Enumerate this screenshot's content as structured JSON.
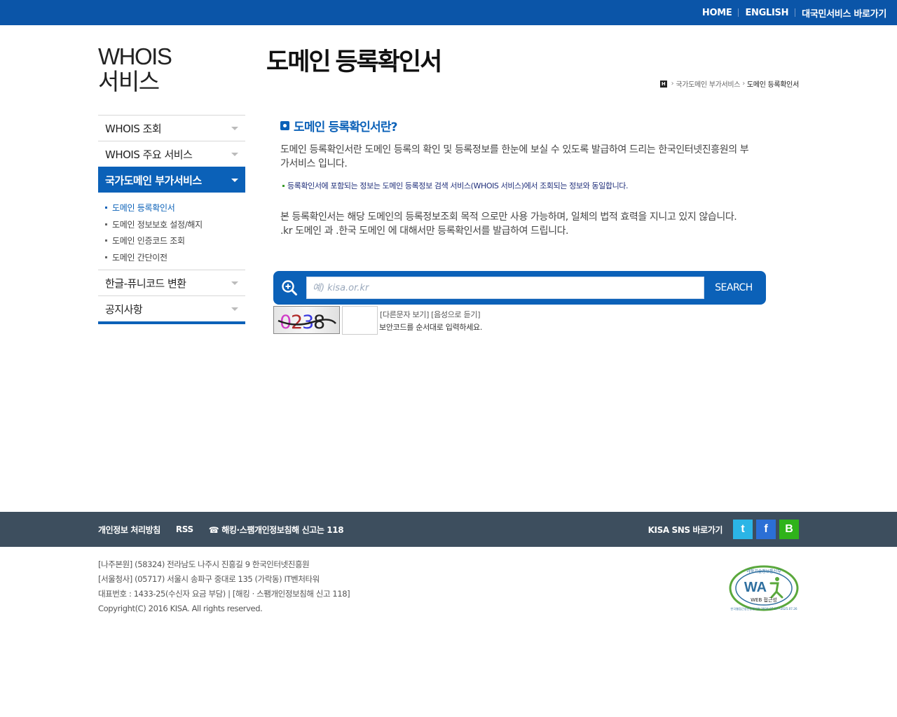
{
  "top_nav": {
    "home": "HOME",
    "english": "ENGLISH",
    "civil_service": "대국민서비스 바로가기"
  },
  "site_title": {
    "line1": "WHOIS",
    "line2": "서비스"
  },
  "page_title": "도메인 등록확인서",
  "breadcrumb": {
    "home_icon": "H",
    "item1": "국가도메인 부가서비스",
    "current": "도메인 등록확인서"
  },
  "side_menu": {
    "items": [
      {
        "label": "WHOIS 조회"
      },
      {
        "label": "WHOIS 주요 서비스"
      },
      {
        "label": "국가도메인 부가서비스"
      },
      {
        "label": "한글-퓨니코드 변환"
      },
      {
        "label": "공지사항"
      }
    ],
    "submenu": [
      {
        "label": "도메인 등록확인서"
      },
      {
        "label": "도메인 정보보호 설정/해지"
      },
      {
        "label": "도메인 인증코드 조회"
      },
      {
        "label": "도메인 간단이전"
      }
    ]
  },
  "content": {
    "section_title": "도메인 등록확인서란?",
    "desc1": "도메인 등록확인서란 도메인 등록의 확인 및 등록정보를 한눈에 보실 수 있도록 발급하여 드리는 한국인터넷진흥원의 부가서비스 입니다.",
    "note": "등록확인서에 포함되는 정보는 도메인 등록정보 검색 서비스(WHOIS 서비스)에서 조회되는 정보와 동일합니다.",
    "desc2_line1": "본 등록확인서는 해당 도메인의 등록정보조회 목적 으로만 사용 가능하며, 일체의 법적 효력을 지니고 있지 않습니다.",
    "desc2_line2": ".kr 도메인 과 .한국 도메인 에 대해서만 등록확인서를 발급하여 드립니다."
  },
  "search": {
    "placeholder": "예) kisa.or.kr",
    "value": "",
    "button": "SEARCH"
  },
  "captcha": {
    "image_text": "0238",
    "other_link": "[다른문자 보기]",
    "audio_link": "[음성으로 듣기]",
    "help": "보안코드를 순서대로 입력하세요."
  },
  "footer": {
    "privacy": "개인정보 처리방침",
    "rss": "RSS",
    "report": "해킹·스팸개인정보침해 신고는 118",
    "sns_label": "KISA SNS 바로가기",
    "sns_twitter": "t",
    "sns_facebook": "f",
    "sns_blog": "B",
    "addr1": "[나주본원] (58324) 전라남도 나주시 진흥길 9 한국인터넷진흥원",
    "addr2": "[서울청사] (05717) 서울시 송파구 중대로 135 (가락동) IT벤처타워",
    "phone": "대표번호 : 1433-25(수신자 요금 부담) | [해킹 · 스팸개인정보침해 신고 118]",
    "copyright": "Copyright(C) 2016 KISA. All rights reserved.",
    "wa_mark": {
      "top_text": "과학기술정보통신부",
      "center": "WA",
      "label": "WEB 접근성",
      "bottom_text": "한국웹접근성인증평가원 2024.07.27~2025.07.26"
    }
  },
  "colors": {
    "brand_blue": "#0b55a8",
    "menu_active": "#0b61b8",
    "footer_bar": "#3d4e5e"
  }
}
